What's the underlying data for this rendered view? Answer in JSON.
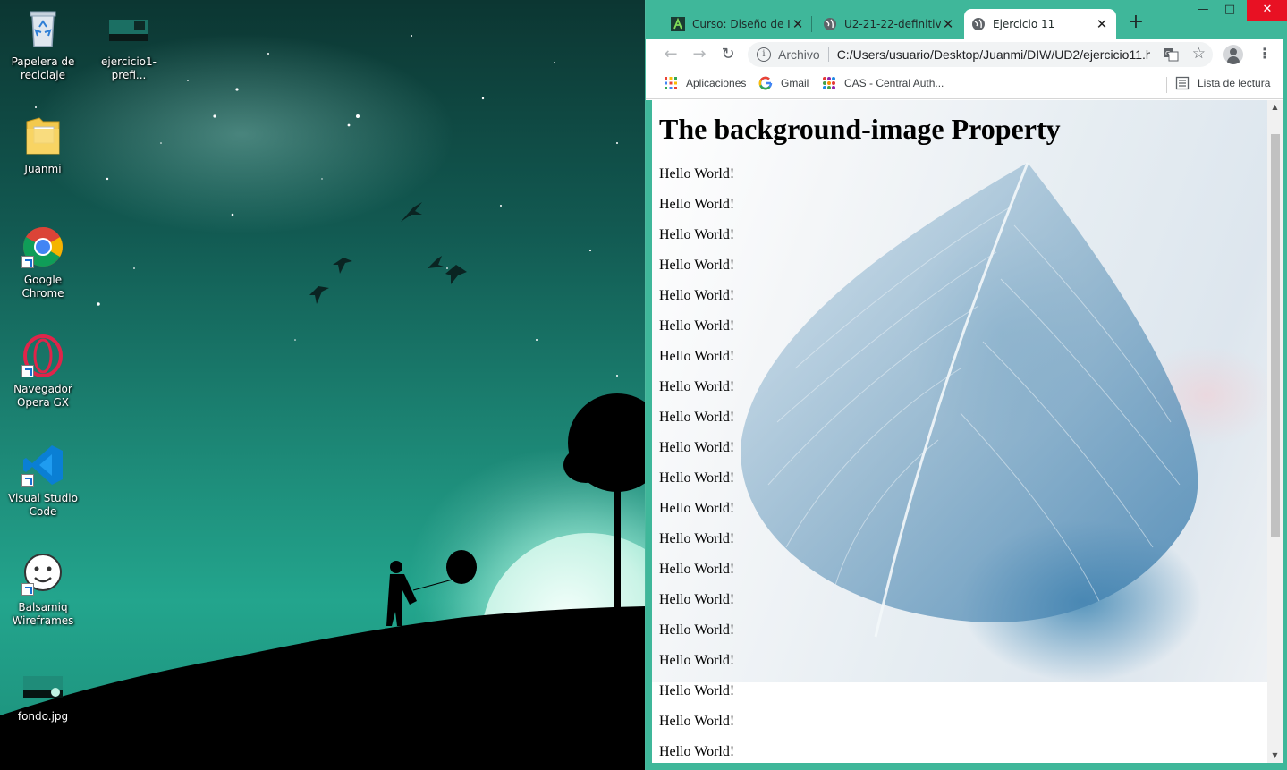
{
  "desktop": {
    "icons": [
      {
        "label": "Papelera de reciclaje",
        "icon": "recycle-bin-icon"
      },
      {
        "label": "ejercicio1-prefi...",
        "icon": "image-file-icon"
      },
      {
        "label": "Juanmi",
        "icon": "folder-icon"
      },
      {
        "label": "Google Chrome",
        "icon": "chrome-icon"
      },
      {
        "label": "Navegador Opera GX",
        "icon": "opera-gx-icon"
      },
      {
        "label": "Visual Studio Code",
        "icon": "vscode-icon"
      },
      {
        "label": "Balsamiq Wireframes",
        "icon": "balsamiq-icon"
      },
      {
        "label": "fondo.jpg",
        "icon": "image-file-icon"
      }
    ]
  },
  "browser": {
    "tabs": [
      {
        "title": "Curso: Diseño de Interfaces",
        "icon": "moodle-icon",
        "active": false
      },
      {
        "title": "U2-21-22-definitivo",
        "icon": "globe-icon",
        "active": false
      },
      {
        "title": "Ejercicio 11",
        "icon": "globe-icon",
        "active": true
      }
    ],
    "new_tab": "+",
    "window_controls": {
      "minimize": "—",
      "maximize": "□",
      "close": "✕"
    },
    "address": {
      "scheme_label": "Archivo",
      "url": "C:/Users/usuario/Desktop/Juanmi/DIW/UD2/ejercicio11.html"
    },
    "bookmarks": [
      {
        "label": "Aplicaciones",
        "icon": "apps-grid-icon"
      },
      {
        "label": "Gmail",
        "icon": "google-icon"
      },
      {
        "label": "CAS - Central Auth...",
        "icon": "cas-icon"
      }
    ],
    "reading_list": "Lista de lectura"
  },
  "page": {
    "heading": "The background-image Property",
    "paragraphs": [
      "Hello World!",
      "Hello World!",
      "Hello World!",
      "Hello World!",
      "Hello World!",
      "Hello World!",
      "Hello World!",
      "Hello World!",
      "Hello World!",
      "Hello World!",
      "Hello World!",
      "Hello World!",
      "Hello World!",
      "Hello World!",
      "Hello World!",
      "Hello World!",
      "Hello World!",
      "Hello World!",
      "Hello World!",
      "Hello World!"
    ]
  },
  "colors": {
    "tab_bar": "#3fb79a",
    "close_button": "#e81123",
    "desktop_teal": "#23a58d"
  }
}
